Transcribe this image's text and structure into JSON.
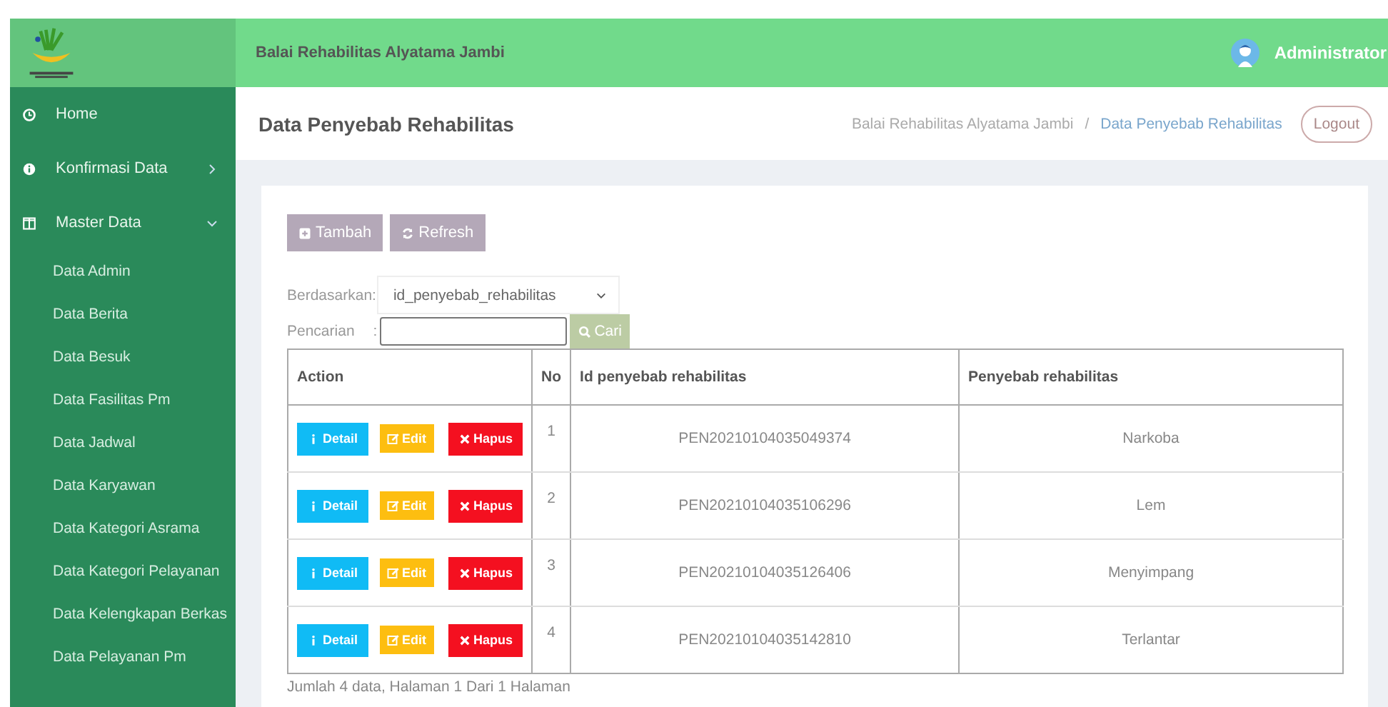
{
  "sidebar": {
    "items": [
      {
        "label": "Home",
        "kind": "link"
      },
      {
        "label": "Konfirmasi Data",
        "kind": "group",
        "expanded": false
      },
      {
        "label": "Master Data",
        "kind": "group",
        "expanded": true,
        "children": [
          {
            "label": "Data Admin"
          },
          {
            "label": "Data Berita"
          },
          {
            "label": "Data Besuk"
          },
          {
            "label": "Data Fasilitas Pm"
          },
          {
            "label": "Data Jadwal"
          },
          {
            "label": "Data Karyawan"
          },
          {
            "label": "Data Kategori Asrama"
          },
          {
            "label": "Data Kategori Pelayanan"
          },
          {
            "label": "Data Kelengkapan Berkas"
          },
          {
            "label": "Data Pelayanan Pm"
          }
        ]
      }
    ]
  },
  "header": {
    "title": "Balai Rehabilitas Alyatama Jambi",
    "user": "Administrator"
  },
  "page": {
    "title": "Data Penyebab Rehabilitas",
    "breadcrumb": [
      "Balai Rehabilitas Alyatama Jambi",
      "Data Penyebab Rehabilitas"
    ],
    "breadcrumb_separator": "/",
    "logout": "Logout"
  },
  "toolbar": [
    {
      "label": "Tambah",
      "kind": "add"
    },
    {
      "label": "Refresh",
      "kind": "refresh"
    }
  ],
  "filter": {
    "label": "Berdasarkan:",
    "value": "id_penyebab_rehabilitas"
  },
  "search": {
    "label": "Pencarian",
    "separator": ":",
    "button": "Cari"
  },
  "table": {
    "columns": [
      "Action",
      "No",
      "Id penyebab rehabilitas",
      "Penyebab rehabilitas"
    ],
    "rows": [
      {
        "actions": [
          {
            "label": "Detail",
            "kind": "detail"
          },
          {
            "label": "Edit",
            "kind": "edit"
          },
          {
            "label": "Hapus",
            "kind": "delete"
          }
        ],
        "no": "1",
        "id": "PEN20210104035049374",
        "penyebab": "Narkoba"
      },
      {
        "actions": [
          {
            "label": "Detail",
            "kind": "detail"
          },
          {
            "label": "Edit",
            "kind": "edit"
          },
          {
            "label": "Hapus",
            "kind": "delete"
          }
        ],
        "no": "2",
        "id": "PEN20210104035106296",
        "penyebab": "Lem"
      },
      {
        "actions": [
          {
            "label": "Detail",
            "kind": "detail"
          },
          {
            "label": "Edit",
            "kind": "edit"
          },
          {
            "label": "Hapus",
            "kind": "delete"
          }
        ],
        "no": "3",
        "id": "PEN20210104035126406",
        "penyebab": "Menyimpang"
      },
      {
        "actions": [
          {
            "label": "Detail",
            "kind": "detail"
          },
          {
            "label": "Edit",
            "kind": "edit"
          },
          {
            "label": "Hapus",
            "kind": "delete"
          }
        ],
        "no": "4",
        "id": "PEN20210104035142810",
        "penyebab": "Terlantar"
      }
    ]
  },
  "footer": "Jumlah 4 data, Halaman 1 Dari 1 Halaman"
}
